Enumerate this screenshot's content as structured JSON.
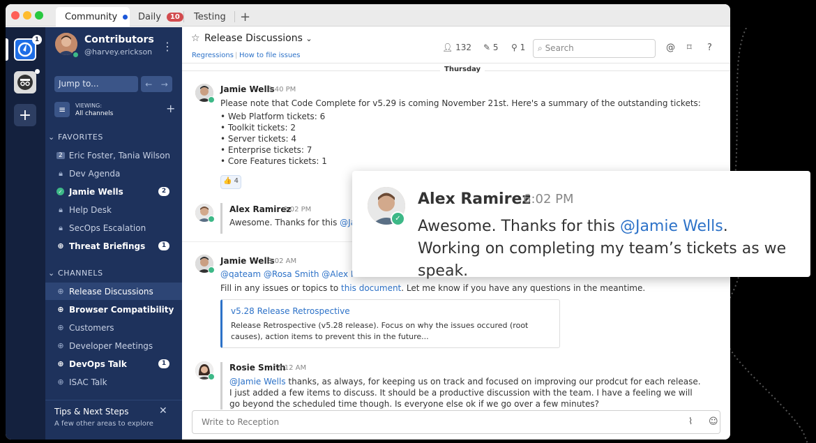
{
  "tabs": [
    {
      "label": "Community",
      "unread": true
    },
    {
      "label": "Daily",
      "badge": "10"
    },
    {
      "label": "Testing"
    },
    {
      "label": "+"
    }
  ],
  "rail": {
    "team1_badge": "1"
  },
  "sidebar": {
    "team_name": "Contributors",
    "handle": "@harvey.erickson",
    "jump_placeholder": "Jump to...",
    "viewing_label": "VIEWING:",
    "viewing_value": "All channels",
    "favorites_title": "FAVORITES",
    "favorites": [
      {
        "label": "Eric Foster, Tania Wilson",
        "icon": "group-dm-icon",
        "count": "2"
      },
      {
        "label": "Dev Agenda",
        "icon": "lock-icon"
      },
      {
        "label": "Jamie Wells",
        "icon": "online-status-icon",
        "badge": "2",
        "bold": true
      },
      {
        "label": "Help Desk",
        "icon": "lock-icon"
      },
      {
        "label": "SecOps Escalation",
        "icon": "lock-icon"
      },
      {
        "label": "Threat Briefings",
        "icon": "globe-icon",
        "badge": "1",
        "bold": true
      }
    ],
    "channels_title": "CHANNELS",
    "channels": [
      {
        "label": "Release Discussions",
        "active": true
      },
      {
        "label": "Browser Compatibility",
        "bold": true
      },
      {
        "label": "Customers"
      },
      {
        "label": "Developer Meetings"
      },
      {
        "label": "DevOps Talk",
        "badge": "1",
        "bold": true
      },
      {
        "label": "ISAC Talk"
      }
    ],
    "tips_title": "Tips & Next Steps",
    "tips_sub": "A few other areas to explore"
  },
  "header": {
    "title": "Release Discussions",
    "sub_link1": "Regressions",
    "sub_link2": "How to file issues",
    "members": "132",
    "pinned_count": "5",
    "flagged": "1",
    "search_placeholder": "Search"
  },
  "day_label": "Thursday",
  "messages": [
    {
      "name": "Jamie Wells",
      "time": "5:40 PM",
      "text": "Please note that Code Complete for v5.29 is coming November 21st. Here's a summary of the outstanding tickets:",
      "bullets": [
        "• Web Platform tickets: 6",
        "• Toolkit tickets: 2",
        "• Server tickets: 4",
        "• Enterprise tickets: 7",
        "• Core Features tickets: 1"
      ],
      "reaction": "👍 4"
    },
    {
      "name": "Alex Ramirez",
      "time": "6:02 PM",
      "text": "Awesome. Thanks for this",
      "mention": "@Jamie"
    },
    {
      "name": "Jamie Wells",
      "time": "8:02 AM",
      "mentions": "@qateam @Rosa Smith @Alex Rami",
      "text_pre": "Fill in any issues or topics to",
      "text_link": "this document",
      "text_post": ". Let me know if you have any questions in the meantime.",
      "quote_title": "v5.28 Release Retrospective",
      "quote_body": "Release Retrospective (v5.28 release). Focus on why the issues occured (root causes), action items to prevent this in the future..."
    },
    {
      "name": "Rosie Smith",
      "time": "9:12 AM",
      "mention": "@Jamie Wells",
      "text": " thanks, as always, for keeping us on track and focused on improving our prodcut for each release. I just added a few items to discuss. It should be a productive discussion with the team. I have a feeling we will go beyond the scheduled time though. Is everyone else ok if we go over a few minutes?"
    }
  ],
  "composer_placeholder": "Write to Reception",
  "popup": {
    "name": "Alex Ramirez",
    "time": "6:02 PM",
    "text_pre": "Awesome. Thanks for this ",
    "mention": "@Jamie Wells",
    "text_post": ". Working on completing my team’s tickets as we speak."
  }
}
